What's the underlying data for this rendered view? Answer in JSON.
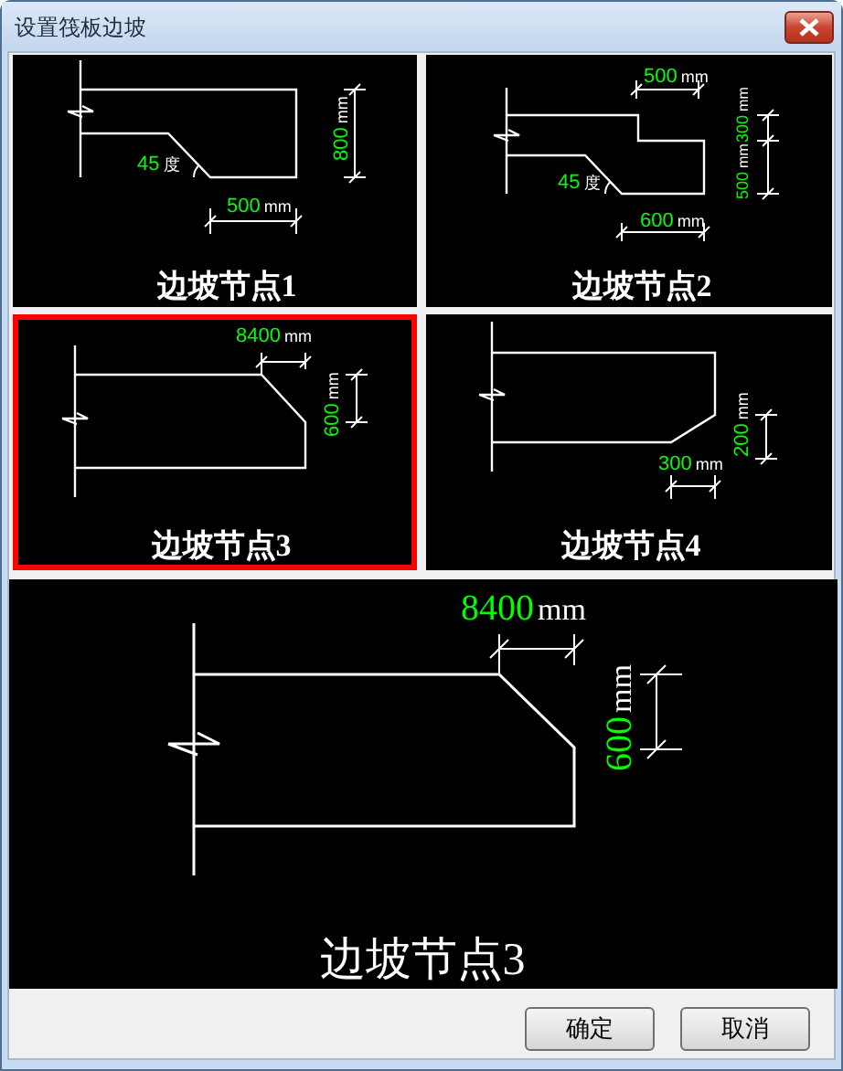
{
  "window": {
    "title": "设置筏板边坡"
  },
  "nodes": [
    {
      "kind": "slope",
      "caption": "边坡节点1",
      "selected": false,
      "labels": [
        {
          "value": "800",
          "unit": "mm"
        },
        {
          "value": "45",
          "unit": "度"
        },
        {
          "value": "500",
          "unit": "mm"
        }
      ]
    },
    {
      "kind": "step",
      "caption": "边坡节点2",
      "selected": false,
      "labels": [
        {
          "value": "500",
          "unit": "mm"
        },
        {
          "value": "300",
          "unit": "mm"
        },
        {
          "value": "500",
          "unit": "mm"
        },
        {
          "value": "45",
          "unit": "度"
        },
        {
          "value": "600",
          "unit": "mm"
        }
      ]
    },
    {
      "kind": "chamfer-top",
      "caption": "边坡节点3",
      "selected": true,
      "labels": [
        {
          "value": "8400",
          "unit": "mm"
        },
        {
          "value": "600",
          "unit": "mm"
        }
      ]
    },
    {
      "kind": "chamfer-bottom",
      "caption": "边坡节点4",
      "selected": false,
      "labels": [
        {
          "value": "200",
          "unit": "mm"
        },
        {
          "value": "300",
          "unit": "mm"
        }
      ]
    }
  ],
  "preview": {
    "kind": "chamfer-top",
    "caption": "边坡节点3",
    "labels": [
      {
        "value": "8400",
        "unit": "mm"
      },
      {
        "value": "600",
        "unit": "mm"
      }
    ]
  },
  "buttons": [
    {
      "label": "确定"
    },
    {
      "label": "取消"
    }
  ]
}
